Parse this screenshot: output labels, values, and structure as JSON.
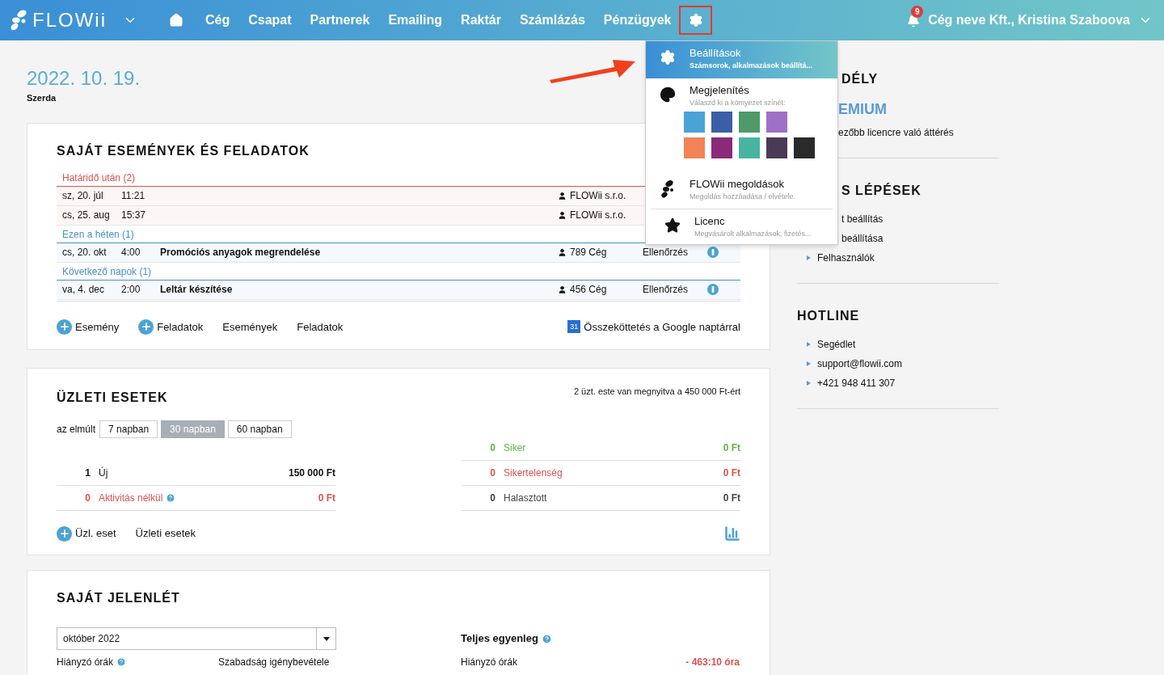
{
  "nav": {
    "logo": "FLOWii",
    "items": [
      "Cég",
      "Csapat",
      "Partnerek",
      "Emailing",
      "Raktár",
      "Számlázás",
      "Pénzügyek"
    ],
    "settings_highlighted": true
  },
  "user": {
    "notifications": "9",
    "name": "Cég neve Kft., Kristina Szaboova"
  },
  "settings_menu": {
    "open": true,
    "items": [
      {
        "kind": "settings",
        "title": "Beállítások",
        "subtitle": "Számsorok, alkalmazások beállítá...",
        "selected": true
      },
      {
        "kind": "appearance",
        "title": "Megjelenítés",
        "subtitle": "Válaszd ki a kömyezet színét:",
        "selected": false,
        "swatch_rows": [
          [
            {
              "color": "#4aa3d6"
            },
            {
              "color": "#3a5fa8"
            },
            {
              "color": "#4f9a68"
            },
            {
              "color": "#a070c8"
            }
          ],
          [
            {
              "color": "#f28258"
            },
            {
              "color": "#8a2a78"
            },
            {
              "color": "#48b4a0"
            },
            {
              "color": "#4a3a58"
            },
            {
              "color": "#2a2a2a"
            }
          ]
        ]
      },
      {
        "kind": "solutions",
        "title": "FLOWii megoldások",
        "subtitle": "Megoldás hozzáadása / elvétele.",
        "selected": false
      },
      {
        "kind": "license",
        "title": "Licenc",
        "subtitle": "Megvásárolt alkalmazások, fizetés...",
        "selected": false
      }
    ]
  },
  "date": {
    "value": "2022. 10. 19.",
    "weekday": "Szerda"
  },
  "events": {
    "title": "SAJÁT ESEMÉNYEK ÉS FELADATOK",
    "groups": [
      {
        "label": "Határidő után (2)",
        "color": "#d9534f",
        "rows": [
          {
            "date": "sz, 20. júl",
            "time": "11:21",
            "partner": "FLOWii s.r.o."
          },
          {
            "date": "cs, 25. aug",
            "time": "15:37",
            "partner": "FLOWii s.r.o."
          }
        ]
      },
      {
        "label": "Ezen a héten (1)",
        "color": "#4a90c8",
        "rows": [
          {
            "date": "cs, 20. okt",
            "time": "4:00",
            "title": "Promóciós anyagok megrendelése",
            "partner": "789 Cég",
            "status": "Ellenőrzés"
          }
        ]
      },
      {
        "label": "Következő napok (1)",
        "color": "#4a90c9",
        "rows": [
          {
            "date": "va, 4. dec",
            "time": "2:00",
            "title": "Leltár készítése",
            "partner": "456 Cég",
            "status": "Ellenőrzés"
          }
        ]
      }
    ],
    "actions": [
      {
        "kind": "add",
        "label": "Esemény"
      },
      {
        "kind": "add",
        "label": "Feladatok"
      },
      {
        "kind": "link",
        "label": "Események"
      },
      {
        "kind": "link",
        "label": "Feladatok"
      },
      {
        "kind": "google",
        "label": "Összeköttetés a Google naptárral",
        "icon_text": "31"
      }
    ]
  },
  "deals": {
    "title": "ÜZLETI ESETEK",
    "summary": "2 üzt. este van megnyitva a 450 000 Ft-ért",
    "period_label": "az elmúlt",
    "periods": [
      {
        "label": "7 napban",
        "selected": false
      },
      {
        "label": "30 napban",
        "selected": true
      },
      {
        "label": "60 napban",
        "selected": false
      }
    ],
    "left": [
      {
        "count": "1",
        "label": "Új",
        "amount": "150 000 Ft",
        "color": "#111111",
        "help": false
      },
      {
        "count": "0",
        "label": "Aktivitás nélkül",
        "amount": "0 Ft",
        "color": "#d9534f",
        "help": true
      }
    ],
    "right": [
      {
        "count": "0",
        "label": "Siker",
        "amount": "0 Ft",
        "color": "#5cb83c",
        "help": false
      },
      {
        "count": "0",
        "label": "Sikertelenség",
        "amount": "0 Ft",
        "color": "#d9534e",
        "help": false
      },
      {
        "count": "0",
        "label": "Halasztott",
        "amount": "0 Ft",
        "color": "#444444",
        "help": false
      }
    ],
    "actions": [
      {
        "kind": "add",
        "label": "Üzl. eset"
      },
      {
        "kind": "link",
        "label": "Üzleti esetek"
      }
    ]
  },
  "attendance": {
    "title": "SAJÁT JELENLÉT",
    "month": "október 2022",
    "balance_title": "Teljes egyenleg",
    "missing_label": "Hiányzó órák",
    "leave_label": "Szabadság igénybevétele",
    "balance_missing_label": "Hiányzó órák",
    "balance_missing_value": "- 463:10 óra"
  },
  "sidebar": {
    "sections": [
      {
        "title": "DÉLY",
        "kind": "covered",
        "highlight": "EMIUM",
        "text": "ezőbb licencre való áttérés"
      },
      {
        "title": "S LÉPÉSEK",
        "kind": "covered",
        "items": [
          {
            "label": "t beállítás",
            "kind": "covered"
          },
          {
            "label": "beállítása",
            "kind": "covered"
          },
          {
            "label": "Felhasználók",
            "kind": "bullet"
          }
        ]
      },
      {
        "title": "HOTLINE",
        "kind": "plain",
        "items": [
          {
            "label": "Segédlet",
            "kind": "bullet"
          },
          {
            "label": "support@flowii.com",
            "kind": "bullet"
          },
          {
            "label": "+421 948 411 307",
            "kind": "bullet"
          }
        ]
      }
    ]
  }
}
